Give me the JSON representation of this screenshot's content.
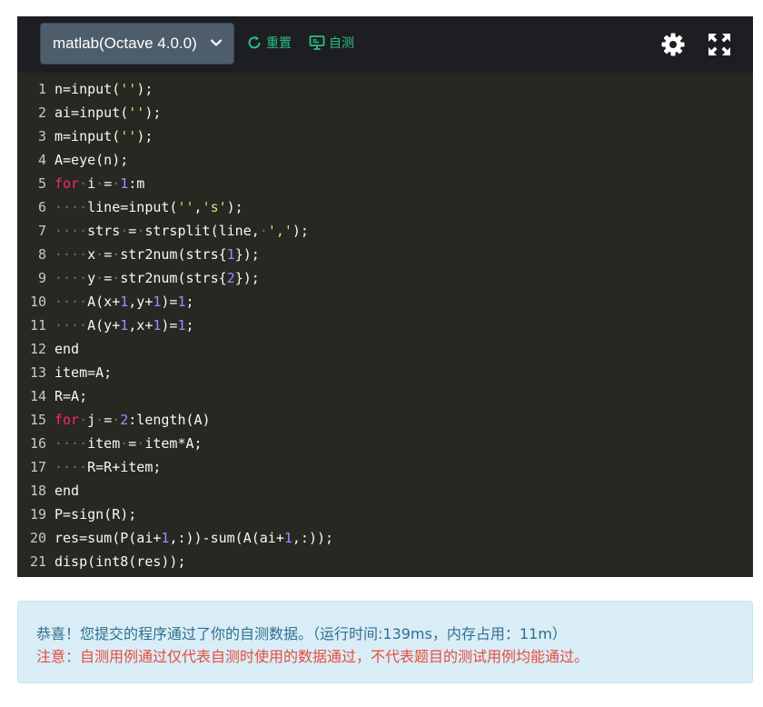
{
  "toolbar": {
    "language": "matlab(Octave 4.0.0)",
    "reset_label": "重置",
    "selftest_label": "自测",
    "accent_color": "#2ebd86",
    "icons": [
      "chevron-down-icon",
      "reset-icon",
      "monitor-icon",
      "gear-icon",
      "expand-icon"
    ]
  },
  "code_lines": [
    {
      "n": "1",
      "tokens": [
        {
          "t": "p",
          "v": "n=input("
        },
        {
          "t": "s",
          "v": "''"
        },
        {
          "t": "p",
          "v": ");"
        }
      ]
    },
    {
      "n": "2",
      "tokens": [
        {
          "t": "p",
          "v": "ai=input("
        },
        {
          "t": "s",
          "v": "''"
        },
        {
          "t": "p",
          "v": ");"
        }
      ]
    },
    {
      "n": "3",
      "tokens": [
        {
          "t": "p",
          "v": "m=input("
        },
        {
          "t": "s",
          "v": "''"
        },
        {
          "t": "p",
          "v": ");"
        }
      ]
    },
    {
      "n": "4",
      "tokens": [
        {
          "t": "p",
          "v": "A=eye(n);"
        }
      ]
    },
    {
      "n": "5",
      "tokens": [
        {
          "t": "k",
          "v": "for"
        },
        {
          "t": "d",
          "v": "·"
        },
        {
          "t": "p",
          "v": "i"
        },
        {
          "t": "d",
          "v": "·"
        },
        {
          "t": "p",
          "v": "="
        },
        {
          "t": "d",
          "v": "·"
        },
        {
          "t": "n",
          "v": "1"
        },
        {
          "t": "p",
          "v": ":m"
        }
      ]
    },
    {
      "n": "6",
      "tokens": [
        {
          "t": "d",
          "v": "····"
        },
        {
          "t": "p",
          "v": "line=input("
        },
        {
          "t": "s",
          "v": "''"
        },
        {
          "t": "p",
          "v": ","
        },
        {
          "t": "s",
          "v": "'s'"
        },
        {
          "t": "p",
          "v": ");"
        }
      ]
    },
    {
      "n": "7",
      "tokens": [
        {
          "t": "d",
          "v": "····"
        },
        {
          "t": "p",
          "v": "strs"
        },
        {
          "t": "d",
          "v": "·"
        },
        {
          "t": "p",
          "v": "="
        },
        {
          "t": "d",
          "v": "·"
        },
        {
          "t": "p",
          "v": "strsplit(line,"
        },
        {
          "t": "d",
          "v": "·"
        },
        {
          "t": "s",
          "v": "','"
        },
        {
          "t": "p",
          "v": ");"
        }
      ]
    },
    {
      "n": "8",
      "tokens": [
        {
          "t": "d",
          "v": "····"
        },
        {
          "t": "p",
          "v": "x"
        },
        {
          "t": "d",
          "v": "·"
        },
        {
          "t": "p",
          "v": "="
        },
        {
          "t": "d",
          "v": "·"
        },
        {
          "t": "p",
          "v": "str2num(strs{"
        },
        {
          "t": "n",
          "v": "1"
        },
        {
          "t": "p",
          "v": "});"
        }
      ]
    },
    {
      "n": "9",
      "tokens": [
        {
          "t": "d",
          "v": "····"
        },
        {
          "t": "p",
          "v": "y"
        },
        {
          "t": "d",
          "v": "·"
        },
        {
          "t": "p",
          "v": "="
        },
        {
          "t": "d",
          "v": "·"
        },
        {
          "t": "p",
          "v": "str2num(strs{"
        },
        {
          "t": "n",
          "v": "2"
        },
        {
          "t": "p",
          "v": "});"
        }
      ]
    },
    {
      "n": "10",
      "tokens": [
        {
          "t": "d",
          "v": "····"
        },
        {
          "t": "p",
          "v": "A(x+"
        },
        {
          "t": "n",
          "v": "1"
        },
        {
          "t": "p",
          "v": ",y+"
        },
        {
          "t": "n",
          "v": "1"
        },
        {
          "t": "p",
          "v": ")="
        },
        {
          "t": "n",
          "v": "1"
        },
        {
          "t": "p",
          "v": ";"
        }
      ]
    },
    {
      "n": "11",
      "tokens": [
        {
          "t": "d",
          "v": "····"
        },
        {
          "t": "p",
          "v": "A(y+"
        },
        {
          "t": "n",
          "v": "1"
        },
        {
          "t": "p",
          "v": ",x+"
        },
        {
          "t": "n",
          "v": "1"
        },
        {
          "t": "p",
          "v": ")="
        },
        {
          "t": "n",
          "v": "1"
        },
        {
          "t": "p",
          "v": ";"
        }
      ]
    },
    {
      "n": "12",
      "tokens": [
        {
          "t": "p",
          "v": "end"
        }
      ]
    },
    {
      "n": "13",
      "tokens": [
        {
          "t": "p",
          "v": "item=A;"
        }
      ]
    },
    {
      "n": "14",
      "tokens": [
        {
          "t": "p",
          "v": "R=A;"
        }
      ]
    },
    {
      "n": "15",
      "tokens": [
        {
          "t": "k",
          "v": "for"
        },
        {
          "t": "d",
          "v": "·"
        },
        {
          "t": "p",
          "v": "j"
        },
        {
          "t": "d",
          "v": "·"
        },
        {
          "t": "p",
          "v": "="
        },
        {
          "t": "d",
          "v": "·"
        },
        {
          "t": "n",
          "v": "2"
        },
        {
          "t": "p",
          "v": ":length(A)"
        }
      ]
    },
    {
      "n": "16",
      "tokens": [
        {
          "t": "d",
          "v": "····"
        },
        {
          "t": "p",
          "v": "item"
        },
        {
          "t": "d",
          "v": "·"
        },
        {
          "t": "p",
          "v": "="
        },
        {
          "t": "d",
          "v": "·"
        },
        {
          "t": "p",
          "v": "item*A;"
        }
      ]
    },
    {
      "n": "17",
      "tokens": [
        {
          "t": "d",
          "v": "····"
        },
        {
          "t": "p",
          "v": "R=R+item;"
        }
      ]
    },
    {
      "n": "18",
      "tokens": [
        {
          "t": "p",
          "v": "end"
        }
      ]
    },
    {
      "n": "19",
      "tokens": [
        {
          "t": "p",
          "v": "P=sign(R);"
        }
      ]
    },
    {
      "n": "20",
      "tokens": [
        {
          "t": "p",
          "v": "res=sum(P(ai+"
        },
        {
          "t": "n",
          "v": "1"
        },
        {
          "t": "p",
          "v": ",:))-sum(A(ai+"
        },
        {
          "t": "n",
          "v": "1"
        },
        {
          "t": "p",
          "v": ",:));"
        }
      ]
    },
    {
      "n": "21",
      "tokens": [
        {
          "t": "p",
          "v": "disp(int8(res));"
        }
      ]
    }
  ],
  "result": {
    "success_text": "恭喜！您提交的程序通过了你的自测数据。（运行时间:139ms，内存占用：11m）",
    "warning_text": "注意：自测用例通过仅代表自测时使用的数据通过，不代表题目的测试用例均能通过。"
  }
}
